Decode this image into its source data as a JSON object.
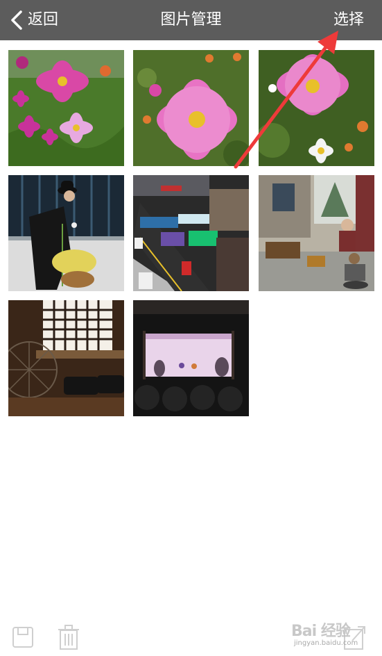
{
  "navbar": {
    "back_label": "返回",
    "title": "图片管理",
    "select_label": "选择"
  },
  "photos": [
    {
      "subject": "pink cosmos flowers with grass"
    },
    {
      "subject": "single pink cosmos flower"
    },
    {
      "subject": "pink cosmos flower close-up"
    },
    {
      "subject": "figure in bowler hat with flower pot"
    },
    {
      "subject": "miniature city street with signboards"
    },
    {
      "subject": "diorama of old street with figures"
    },
    {
      "subject": "spinning wheel and sewing machines by window"
    },
    {
      "subject": "shadow puppet theater stage"
    }
  ],
  "toolbar": {
    "save_icon": "save-icon",
    "delete_icon": "trash-icon",
    "share_icon": "share-icon"
  },
  "watermark": {
    "main": "Bai 经验",
    "sub": "jingyan.baidu.com"
  },
  "colors": {
    "navbar": "#5c5c5c",
    "annotation_arrow": "#ee3a3a"
  }
}
